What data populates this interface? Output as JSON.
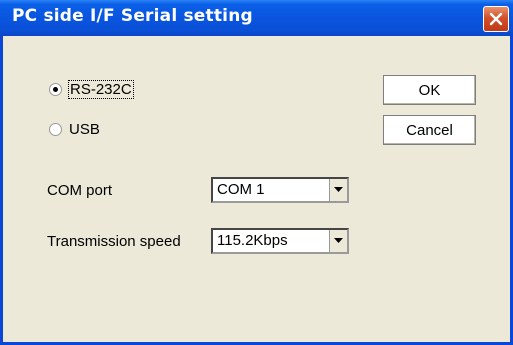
{
  "window": {
    "title": "PC side I/F  Serial setting"
  },
  "connection": {
    "options": [
      {
        "label": "RS-232C",
        "selected": true
      },
      {
        "label": "USB",
        "selected": false
      }
    ]
  },
  "buttons": {
    "ok": "OK",
    "cancel": "Cancel"
  },
  "com_port": {
    "label": "COM port",
    "value": "COM 1"
  },
  "transmission_speed": {
    "label": "Transmission speed",
    "value": "115.2Kbps"
  },
  "colors": {
    "titlebar": "#0a55e0",
    "background": "#ece9d8",
    "close_button": "#d2512a"
  }
}
